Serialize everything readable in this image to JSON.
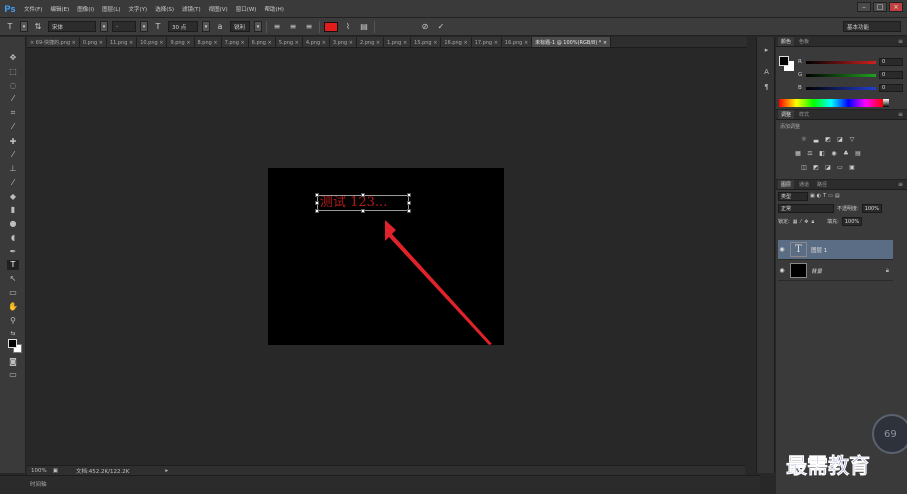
{
  "app": {
    "logo": "Ps"
  },
  "menu": [
    "文件(F)",
    "编辑(E)",
    "图像(I)",
    "图层(L)",
    "文字(Y)",
    "选择(S)",
    "滤镜(T)",
    "视图(V)",
    "窗口(W)",
    "帮助(H)"
  ],
  "options": {
    "font_family": "宋体",
    "font_style": "-",
    "font_size": "30 点",
    "antialias_label": "a",
    "antialias": "锐利",
    "text_color": "#e31c1c",
    "workspace": "基本功能"
  },
  "tabs": [
    "69-快捷的.png",
    "0.png",
    "11.png",
    "10.png",
    "9.png",
    "8.png",
    "7.png",
    "6.png",
    "5.png",
    "4.png",
    "3.png",
    "2.png",
    "1.png",
    "15.png",
    "16.png",
    "17.png",
    "16.png",
    "未标题-1 @ 100%(RGB/8) *"
  ],
  "document": {
    "text": "测试 123..."
  },
  "status": {
    "zoom": "100%",
    "doc_info": "文档:452.2K/122.2K"
  },
  "timeline": {
    "label": "时间轴"
  },
  "color_panel": {
    "tabs": [
      "颜色",
      "色板"
    ],
    "sliders": [
      {
        "label": "R",
        "value": "0",
        "color": "#d02020"
      },
      {
        "label": "G",
        "value": "0",
        "color": "#20a020"
      },
      {
        "label": "B",
        "value": "0",
        "color": "#2040d0"
      }
    ]
  },
  "adjust_panel": {
    "tabs": [
      "调整",
      "样式"
    ],
    "caption": "添加调整"
  },
  "layers_panel": {
    "tabs": [
      "图层",
      "通道",
      "路径"
    ],
    "filter": "类型",
    "blend_mode": "正常",
    "opacity_label": "不透明度:",
    "opacity": "100%",
    "lock_label": "锁定:",
    "fill_label": "填充:",
    "fill": "100%",
    "layers": [
      {
        "name": "图层 1",
        "thumb": "T",
        "selected": true
      },
      {
        "name": "背景",
        "thumb": "",
        "selected": false
      }
    ]
  },
  "watermark": {
    "text": "最需教育",
    "badge": "69"
  }
}
